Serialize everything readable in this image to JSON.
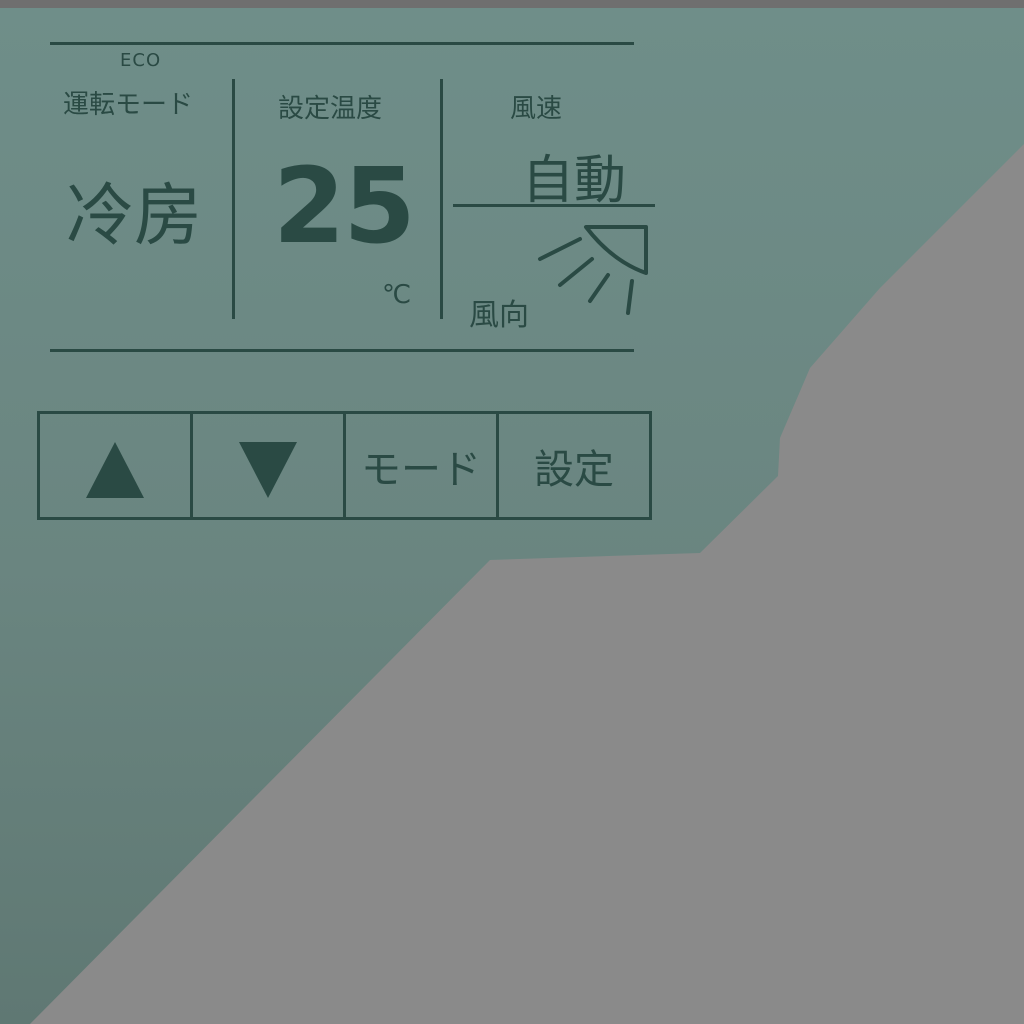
{
  "display": {
    "eco": "ECO",
    "mode_label": "運転モード",
    "mode_value": "冷房",
    "temp_label": "設定温度",
    "temp_value": "25",
    "temp_unit": "℃",
    "fan_label": "風速",
    "fan_value": "自動",
    "direction_label": "風向",
    "direction_icon": "louver-direction-icon"
  },
  "buttons": {
    "up_icon": "triangle-up-icon",
    "down_icon": "triangle-down-icon",
    "mode": "モード",
    "settings": "設定"
  },
  "colors": {
    "ink": "#2a4a44",
    "panel": "#6f8e89",
    "background": "#8a8a8a"
  }
}
